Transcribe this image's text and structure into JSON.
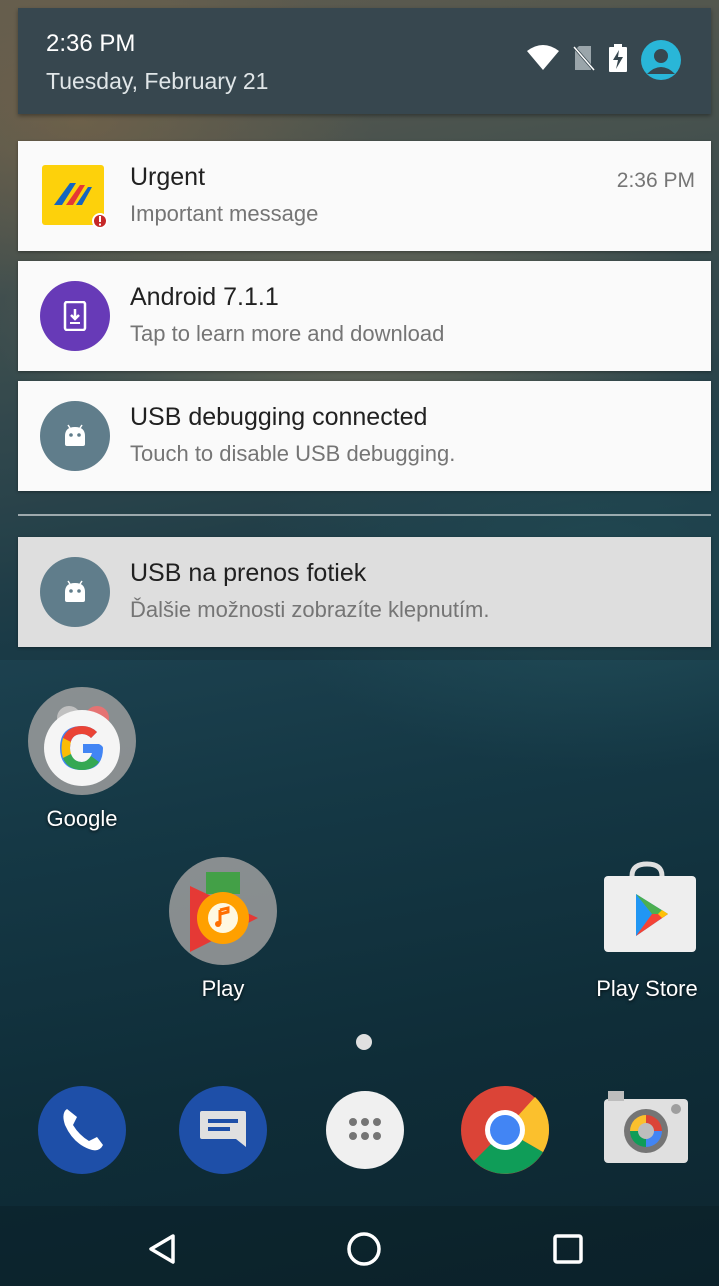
{
  "status": {
    "time": "2:36 PM",
    "date": "Tuesday, February 21",
    "icons": [
      "wifi-icon",
      "no-sim-icon",
      "battery-charging-icon",
      "user-avatar-icon"
    ]
  },
  "notifications": [
    {
      "title": "Urgent",
      "subtitle": "Important message",
      "timestamp": "2:36 PM",
      "icon": "app-logo-icon"
    },
    {
      "title": "Android 7.1.1",
      "subtitle": "Tap to learn more and download",
      "icon": "system-update-icon"
    },
    {
      "title": "USB debugging connected",
      "subtitle": "Touch to disable USB debugging.",
      "icon": "android-icon"
    },
    {
      "title": "USB na prenos fotiek",
      "subtitle": "Ďalšie možnosti zobrazíte klepnutím.",
      "icon": "android-icon"
    }
  ],
  "home": {
    "apps": [
      {
        "label": "Google",
        "icon": "google-folder-icon"
      },
      {
        "label": "Play",
        "icon": "play-folder-icon"
      },
      {
        "label": "Play Store",
        "icon": "play-store-icon"
      }
    ],
    "dock": [
      "phone-icon",
      "messages-icon",
      "app-drawer-icon",
      "chrome-icon",
      "camera-icon"
    ]
  },
  "nav": [
    "back-icon",
    "home-icon",
    "recents-icon"
  ],
  "colors": {
    "header": "#37474f",
    "update_purple": "#673ab7",
    "android_gray": "#607d8b",
    "avatar_blue": "#29b6d8"
  }
}
